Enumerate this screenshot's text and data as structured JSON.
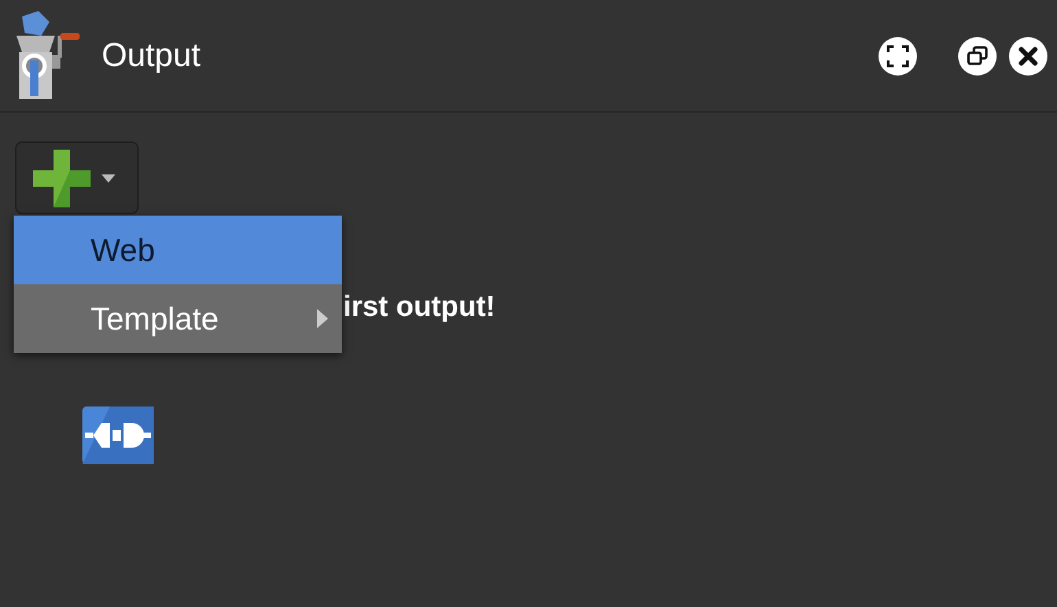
{
  "window": {
    "title": "Output"
  },
  "add_menu": {
    "items": [
      {
        "label": "Web",
        "selected": true,
        "submenu": false
      },
      {
        "label": "Template",
        "selected": false,
        "submenu": true
      }
    ]
  },
  "empty_message": "irst output!"
}
